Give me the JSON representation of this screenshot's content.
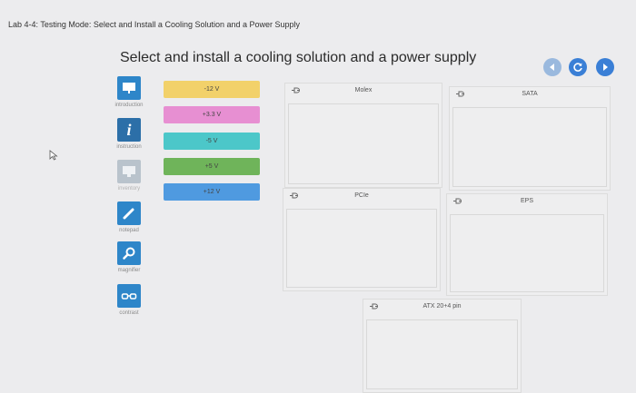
{
  "window": {
    "title": "Lab 4-4: Testing Mode: Select and Install a Cooling Solution and a Power Supply"
  },
  "page": {
    "title": "Select and install a cooling solution and a power supply"
  },
  "nav": {
    "back_icon": "back-arrow-icon",
    "reset_icon": "reset-icon",
    "next_icon": "next-arrow-icon"
  },
  "toolbar": [
    {
      "label": "introduction",
      "icon": "introduction-icon"
    },
    {
      "label": "instruction",
      "icon": "info-icon"
    },
    {
      "label": "inventory",
      "icon": "inventory-icon"
    },
    {
      "label": "notepad",
      "icon": "pencil-icon"
    },
    {
      "label": "magnifier",
      "icon": "magnifier-icon"
    },
    {
      "label": "contrast",
      "icon": "glasses-icon"
    }
  ],
  "voltages": [
    {
      "label": "-12 V",
      "color": "#f2d16a"
    },
    {
      "label": "+3.3 V",
      "color": "#e78fd2"
    },
    {
      "label": "-5 V",
      "color": "#4cc7c9"
    },
    {
      "label": "+5 V",
      "color": "#6fb45a"
    },
    {
      "label": "+12 V",
      "color": "#4f9ae0"
    }
  ],
  "connectors": [
    {
      "label": "Molex"
    },
    {
      "label": "SATA"
    },
    {
      "label": "PCIe"
    },
    {
      "label": "EPS"
    },
    {
      "label": "ATX 20+4 pin"
    }
  ]
}
